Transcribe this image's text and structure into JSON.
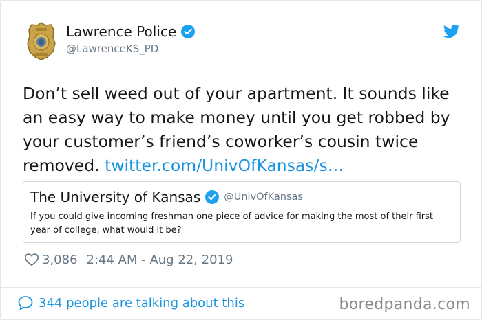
{
  "tweet": {
    "author_name": "Lawrence Police",
    "author_handle": "@LawrenceKS_PD",
    "text": "Don’t sell weed out of your apartment. It sounds like\nan easy way to make money until you get robbed by\nyour customer’s friend’s coworker’s cousin twice\nremoved. ",
    "link_text": "twitter.com/UnivOfKansas/s…",
    "likes": "3,086",
    "timestamp": "2:44 AM - Aug 22, 2019",
    "conversation_text": "344 people are talking about this"
  },
  "quoted_tweet": {
    "author_name": "The University of Kansas",
    "author_handle": "@UnivOfKansas",
    "text": "If you could give incoming freshman one piece of advice for making the most of their first year of college, what would it be?"
  },
  "watermark": "boredpanda.com",
  "icons": {
    "avatar": "police-badge-icon",
    "verified": "verified-badge-icon",
    "brand": "twitter-bird-icon",
    "like": "heart-icon",
    "reply": "speech-bubble-icon"
  },
  "colors": {
    "link": "#1b95e0",
    "verified": "#1da1f2",
    "muted": "#657786",
    "border": "#e1e8ed"
  }
}
